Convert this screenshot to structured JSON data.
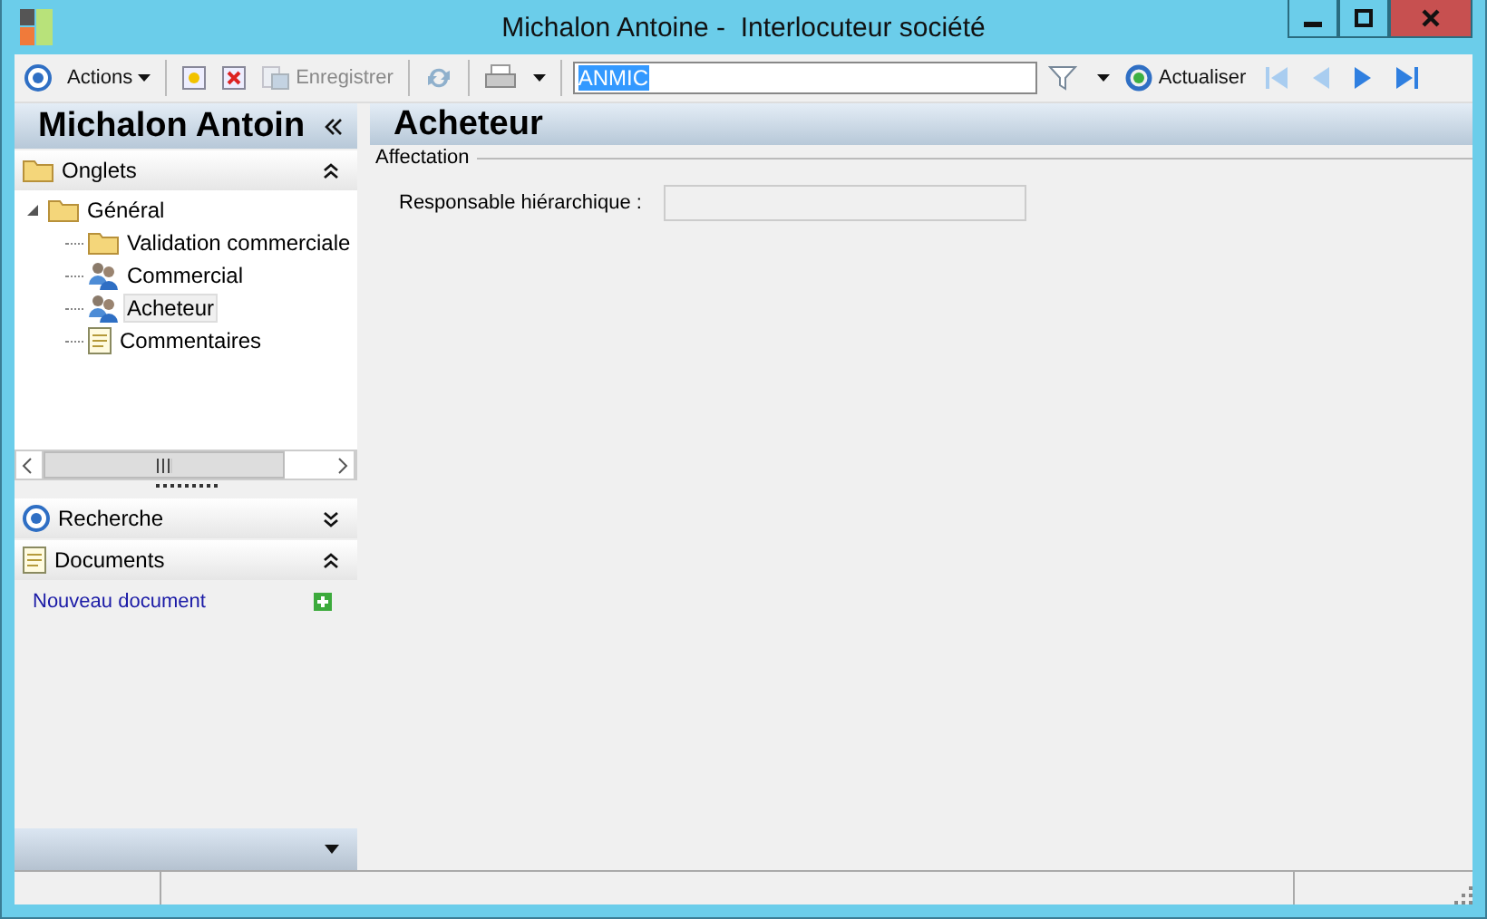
{
  "window": {
    "title": "Michalon Antoine -  Interlocuteur société"
  },
  "toolbar": {
    "actions": "Actions",
    "save": {
      "label": "Enregistrer",
      "disabled": true
    },
    "search": {
      "value": "ANMIC"
    },
    "refresh": "Actualiser"
  },
  "sidebar": {
    "title": "Michalon Antoin",
    "sections": [
      {
        "kind": "tree",
        "title": "Onglets",
        "expanded": true,
        "tree": [
          {
            "label": "Général",
            "kind": "folder",
            "expanded": true,
            "selected": false,
            "children": [
              {
                "label": "Validation commerciale",
                "kind": "folder",
                "selected": false
              },
              {
                "label": "Commercial",
                "kind": "people",
                "selected": false
              },
              {
                "label": "Acheteur",
                "kind": "people",
                "selected": true
              },
              {
                "label": "Commentaires",
                "kind": "note",
                "selected": false
              }
            ]
          }
        ]
      },
      {
        "kind": "search",
        "title": "Recherche",
        "expanded": false
      },
      {
        "kind": "documents",
        "title": "Documents",
        "expanded": true,
        "links": [
          "Nouveau document"
        ]
      }
    ]
  },
  "main": {
    "title": "Acheteur",
    "group": "Affectation",
    "fields": [
      {
        "label": "Responsable hiérarchique :"
      }
    ]
  }
}
